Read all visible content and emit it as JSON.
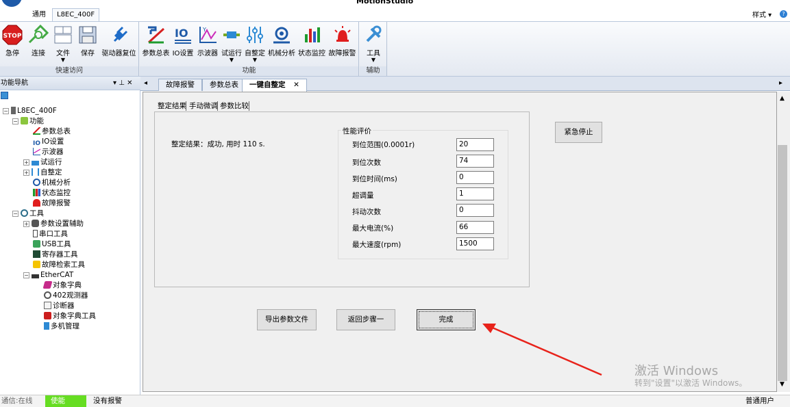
{
  "app": {
    "title": "MotionStudio"
  },
  "ribbon_tabs": [
    "通用",
    "L8EC_400F"
  ],
  "style_menu": "样式 ▾",
  "groups": {
    "quick": {
      "title": "快速访问",
      "buttons": [
        "急停",
        "连接",
        "文件",
        "保存",
        "驱动器复位"
      ]
    },
    "func": {
      "title": "功能",
      "buttons": [
        "参数总表",
        "IO设置",
        "示波器",
        "试运行",
        "自整定",
        "机械分析",
        "状态监控",
        "故障报警"
      ]
    },
    "aux": {
      "title": "辅助",
      "buttons": [
        "工具"
      ]
    }
  },
  "nav": {
    "title": "功能导航",
    "pin": "▾ ⊥ ✕",
    "tree": {
      "root": "L8EC_400F",
      "func": "功能",
      "func_items": [
        "参数总表",
        "IO设置",
        "示波器",
        "试运行",
        "自整定",
        "机械分析",
        "状态监控",
        "故障报警"
      ],
      "tools": "工具",
      "tool_items": [
        "参数设置辅助",
        "串口工具",
        "USB工具",
        "寄存器工具",
        "故障检索工具"
      ],
      "ethercat": "EtherCAT",
      "ec_items": [
        "对象字典",
        "402观测器",
        "诊断器",
        "对象字典工具",
        "多机管理"
      ]
    }
  },
  "doc_tabs": [
    "故障报警",
    "参数总表",
    "一键自整定"
  ],
  "subtabs": [
    "整定结果",
    "手动微调",
    "参数比较"
  ],
  "result_text": "整定结果：成功, 用时 110 s.",
  "perf": {
    "title": "性能评价",
    "rows": [
      {
        "label": "到位范围(0.0001r)",
        "value": "20"
      },
      {
        "label": "到位次数",
        "value": "74"
      },
      {
        "label": "到位时间(ms)",
        "value": "0"
      },
      {
        "label": "超调量",
        "value": "1"
      },
      {
        "label": "抖动次数",
        "value": "0"
      },
      {
        "label": "最大电流(%)",
        "value": "66"
      },
      {
        "label": "最大速度(rpm)",
        "value": "1500"
      }
    ]
  },
  "buttons": {
    "estop": "紧急停止",
    "export": "导出参数文件",
    "back": "返回步骤一",
    "done": "完成"
  },
  "watermark": {
    "line1": "激活 Windows",
    "line2": "转到\"设置\"以激活 Windows。"
  },
  "status": {
    "comm": "通信:在线",
    "enable": "使能",
    "alarm": "没有报警",
    "user": "普通用户"
  },
  "colors": {
    "enable_bg": "#66dd22",
    "arrow": "#e8231b",
    "accent": "#1e5aa8"
  }
}
